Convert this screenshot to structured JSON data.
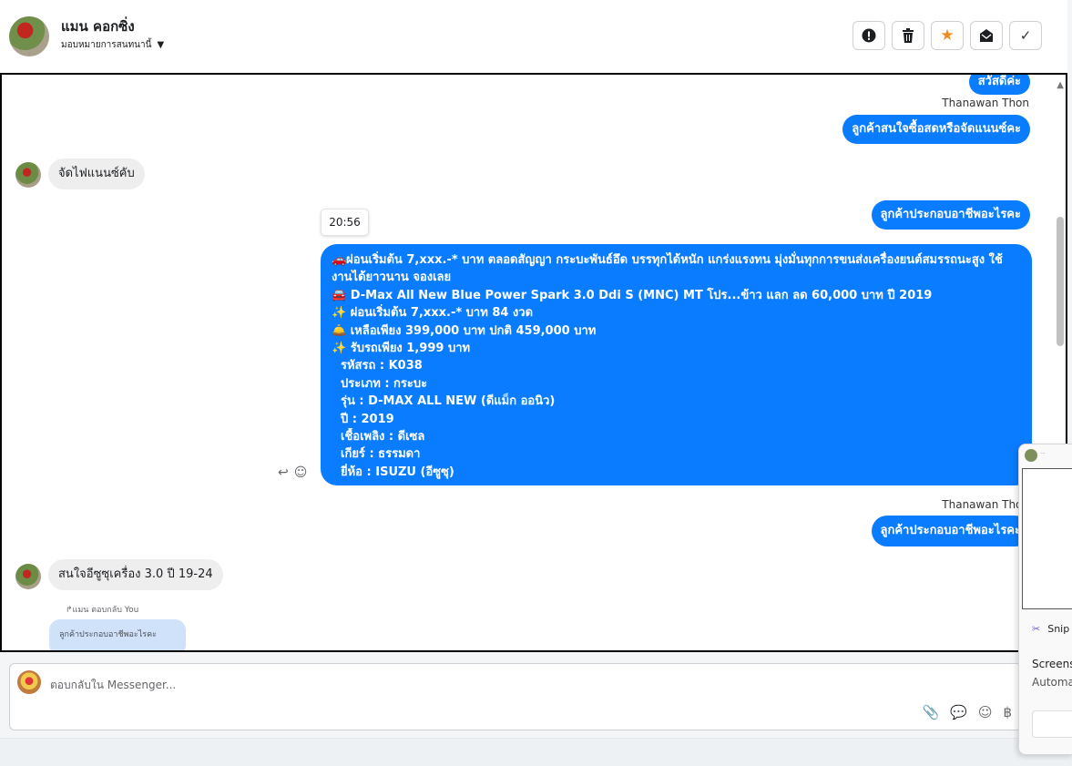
{
  "header": {
    "contact_name": "แมน คอกซิ่ง",
    "assign_label": "มอบหมายการสนทนานี้",
    "caret_icon": "caret-down-icon",
    "actions": [
      {
        "name": "spam",
        "icon": "alert-circle-icon",
        "glyph": "❗"
      },
      {
        "name": "delete",
        "icon": "trash-icon",
        "glyph": "🗑"
      },
      {
        "name": "star",
        "icon": "star-icon",
        "glyph": "★"
      },
      {
        "name": "unread",
        "icon": "mail-open-icon",
        "glyph": "✉"
      },
      {
        "name": "done",
        "icon": "check-icon",
        "glyph": "✓"
      }
    ]
  },
  "messages": {
    "m1_out": "สวัสดีค่ะ",
    "sender1": "Thanawan Thon",
    "m2_out": "ลูกค้าสนใจซื้อสดหรือจัดแนนซ์คะ",
    "m3_in": "จัดไฟแนนซ์คับ",
    "m4_out": "ลูกค้าประกอบอาชีพอะไรคะ",
    "time": "20:56",
    "long_lines": [
      "🚗ผ่อนเริ่มต้น 7,xxx.-* บาท ตลอดสัญญา กระบะพันธ์อึด บรรทุกได้หนัก แกร่งแรงทน มุ่งมั่นทุกการขนส่งเครื่องยนต์สมรรถนะสูง ใช้",
      "งานได้ยาวนาน จองเลย",
      "🚘 D-Max All New Blue Power Spark 3.0 Ddi S (MNC) MT โปร...ข้าว แลก ลด 60,000 บาท ปี 2019",
      "✨ ผ่อนเริ่มต้น 7,xxx.-* บาท 84 งวด",
      "🛎️ เหลือเพียง 399,000 บาท ปกติ 459,000 บาท",
      "✨ รับรถเพียง 1,999 บาท",
      "รหัสรถ : K038",
      "ประเภท : กระบะ",
      "รุ่น : D-MAX ALL NEW (ดีแม็ก ออนิว)",
      "ปี : 2019",
      "เชื้อเพลิง : ดีเซล",
      "เกียร์ : ธรรมดา",
      "ยี่ห้อ : ISUZU (อีซูซุ)"
    ],
    "sender2": "Thanawan Thon",
    "m5_out": "ลูกค้าประกอบอาชีพอะไรคะ",
    "m6_in": "สนใจอีซูซุเครื่อง 3.0  ปี 19-24",
    "reply_tag": "↱แมน ตอบกลับ You",
    "quote_text": "ลูกค้าประกอบอาชีพอะไรคะ"
  },
  "composer": {
    "placeholder": "ตอบกลับใน Messenger...",
    "icons": [
      "paperclip-icon",
      "chat-icon",
      "emoji-icon",
      "baht-icon"
    ]
  },
  "popup": {
    "app_name": "Snip",
    "title": "Screens",
    "subtitle": "Automa"
  },
  "colors": {
    "outgoing_bubble": "#0a7cff",
    "incoming_bubble": "#eeeeef",
    "star": "#f08c1e"
  }
}
